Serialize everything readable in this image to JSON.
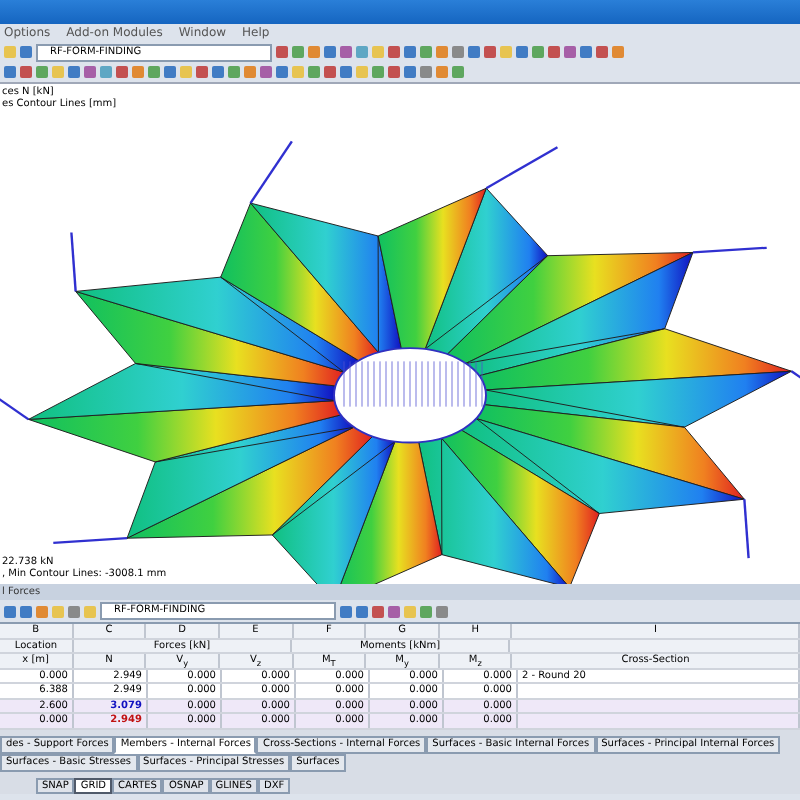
{
  "menu": [
    "Options",
    "Add-on Modules",
    "Window",
    "Help"
  ],
  "toolbar": {
    "case_dropdown": "RF-FORM-FINDING"
  },
  "viewport": {
    "info_top": [
      "ces N [kN]",
      "es Contour Lines [mm]"
    ],
    "info_bottom": [
      "22.738 kN",
      ", Min Contour Lines: -3008.1 mm"
    ]
  },
  "panel": {
    "title": "l Forces",
    "case_dropdown": "RF-FORM-FINDING"
  },
  "table": {
    "letters": [
      "B",
      "C",
      "D",
      "E",
      "F",
      "G",
      "H",
      "I"
    ],
    "groups": [
      "Location",
      "Forces [kN]",
      "Moments [kNm]"
    ],
    "columns": [
      "x [m]",
      "N",
      "V$_{y}$",
      "V$_{z}$",
      "M$_{T}$",
      "M$_{y}$",
      "M$_{z}$",
      "Cross-Section"
    ],
    "rows": [
      {
        "highlighted": false,
        "kind": "normal",
        "cells": [
          "0.000",
          "2.949",
          "0.000",
          "0.000",
          "0.000",
          "0.000",
          "0.000",
          "2 - Round 20"
        ]
      },
      {
        "highlighted": false,
        "kind": "normal",
        "cells": [
          "6.388",
          "2.949",
          "0.000",
          "0.000",
          "0.000",
          "0.000",
          "0.000",
          ""
        ]
      },
      {
        "highlighted": true,
        "kind": "max",
        "cells": [
          "2.600",
          "3.079",
          "0.000",
          "0.000",
          "0.000",
          "0.000",
          "0.000",
          ""
        ]
      },
      {
        "highlighted": true,
        "kind": "min",
        "cells": [
          "0.000",
          "2.949",
          "0.000",
          "0.000",
          "0.000",
          "0.000",
          "0.000",
          ""
        ]
      }
    ]
  },
  "tabs": [
    {
      "label": "des - Support Forces",
      "selected": false
    },
    {
      "label": "Members - Internal Forces",
      "selected": true
    },
    {
      "label": "Cross-Sections - Internal Forces",
      "selected": false
    },
    {
      "label": "Surfaces - Basic Internal Forces",
      "selected": false
    },
    {
      "label": "Surfaces - Principal Internal Forces",
      "selected": false
    },
    {
      "label": "Surfaces - Basic Stresses",
      "selected": false
    },
    {
      "label": "Surfaces - Principal Stresses",
      "selected": false
    },
    {
      "label": "Surfaces",
      "selected": false
    }
  ],
  "status_bar": [
    {
      "label": "SNAP",
      "on": false
    },
    {
      "label": "GRID",
      "on": true
    },
    {
      "label": "CARTES",
      "on": false
    },
    {
      "label": "OSNAP",
      "on": false
    },
    {
      "label": "GLINES",
      "on": false
    },
    {
      "label": "DXF",
      "on": false
    }
  ]
}
